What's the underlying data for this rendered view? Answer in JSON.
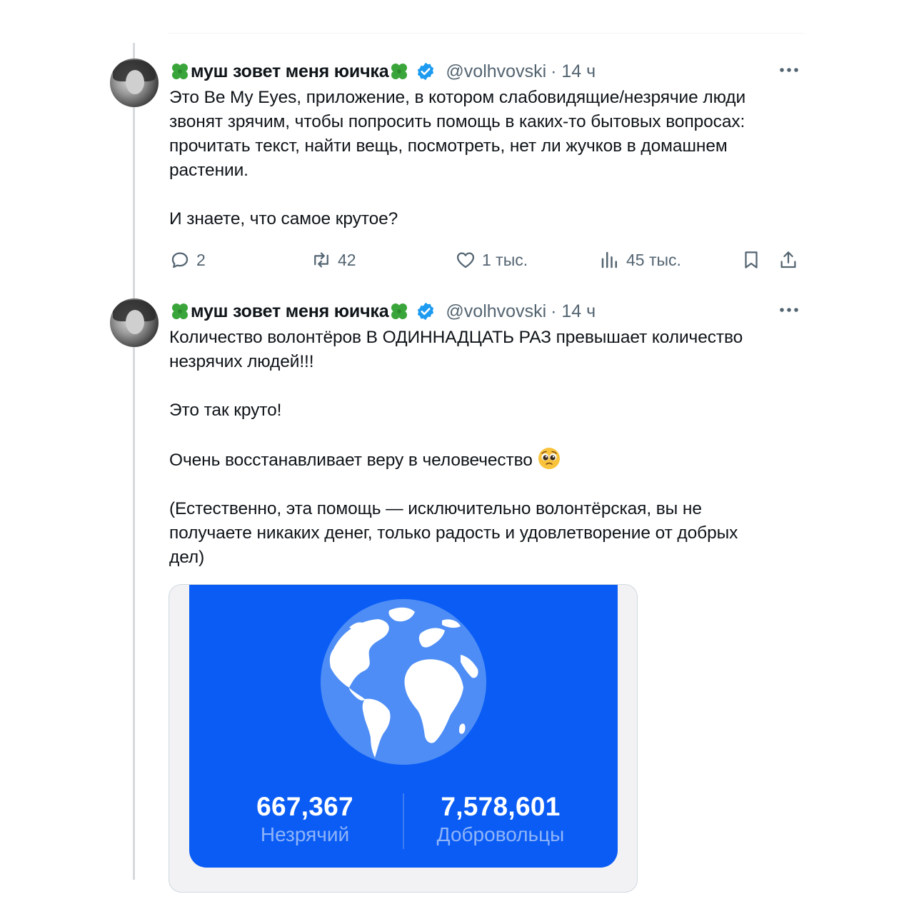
{
  "colors": {
    "accent": "#1d9bf0",
    "text": "#0f1419",
    "muted": "#536471",
    "card": "#0a5cf5"
  },
  "posts": [
    {
      "display_name": "муш зовет меня юичка",
      "handle": "@volhvovski",
      "time": "· 14 ч",
      "text": "Это Be My Eyes, приложение, в котором слабовидящие/незрячие люди\nзвонят зрячим, чтобы попросить помощь в каких-то бытовых вопросах:\nпрочитать текст, найти вещь, посмотреть, нет ли жучков в домашнем\nрастении.\n\nИ знаете, что самое крутое?",
      "replies": "2",
      "reposts": "42",
      "likes": "1 тыс.",
      "views": "45 тыс."
    },
    {
      "display_name": "муш зовет меня юичка",
      "handle": "@volhvovski",
      "time": "· 14 ч",
      "text_lines": [
        "Количество волонтёров В ОДИННАДЦАТЬ РАЗ превышает количество\nнезрячих людей!!!\n\nЭто так круто!\n\nОчень восстанавливает веру в человечество ",
        "\n\n(Естественно, эта помощь — исключительно волонтёрская, вы не\nполучаете никаких денег, только радость и удовлетворение от добрых\nдел)"
      ],
      "emoji": "pleading-face",
      "media": {
        "stats": [
          {
            "value": "667,367",
            "label": "Незрячий"
          },
          {
            "value": "7,578,601",
            "label": "Добровольцы"
          }
        ]
      }
    }
  ]
}
